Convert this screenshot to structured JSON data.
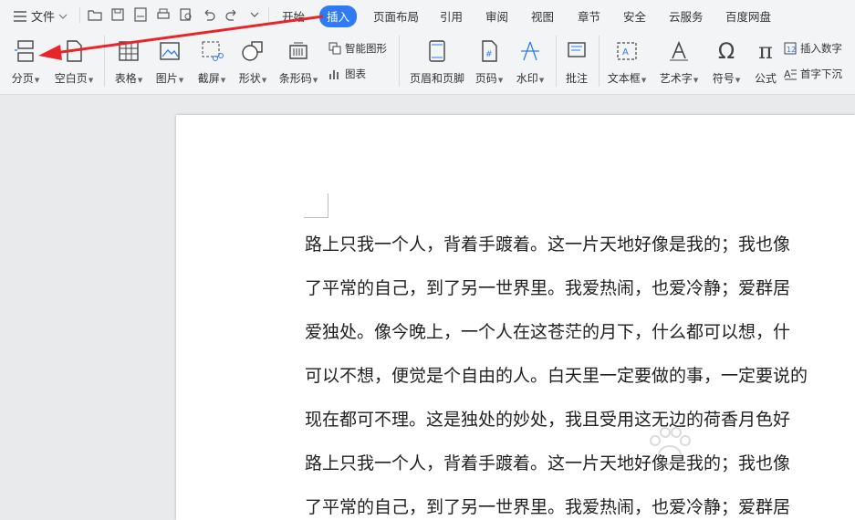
{
  "menubar": {
    "file_label": "文件",
    "tabs": [
      "开始",
      "插入",
      "页面布局",
      "引用",
      "审阅",
      "视图",
      "章节",
      "安全",
      "云服务",
      "百度网盘"
    ],
    "active_tab": "插入"
  },
  "ribbon": {
    "page_break": "分页",
    "blank_page": "空白页",
    "table": "表格",
    "picture": "图片",
    "screenshot": "截屏",
    "shape": "形状",
    "barcode": "条形码",
    "smart_shape": "智能图形",
    "chart": "图表",
    "header_footer": "页眉和页脚",
    "page_number": "页码",
    "watermark": "水印",
    "comment": "批注",
    "textbox": "文本框",
    "wordart": "艺术字",
    "symbol": "符号",
    "formula": "公式",
    "insert_number": "插入数字",
    "drop_cap": "首字下沉"
  },
  "document": {
    "lines": [
      "路上只我一个人，背着手踱着。这一片天地好像是我的；我也像",
      "了平常的自己，到了另一世界里。我爱热闹，也爱冷静；爱群居",
      "爱独处。像今晚上，一个人在这苍茫的月下，什么都可以想，什",
      "可以不想，便觉是个自由的人。白天里一定要做的事，一定要说的",
      "现在都可不理。这是独处的妙处，我且受用这无边的荷香月色好",
      "路上只我一个人，背着手踱着。这一片天地好像是我的；我也像",
      "了平常的自己，到了另一世界里。我爱热闹，也爱冷静；爱群居"
    ]
  },
  "annotation": {
    "arrow_color": "#e8262a",
    "accent": "#2f7bf5"
  }
}
